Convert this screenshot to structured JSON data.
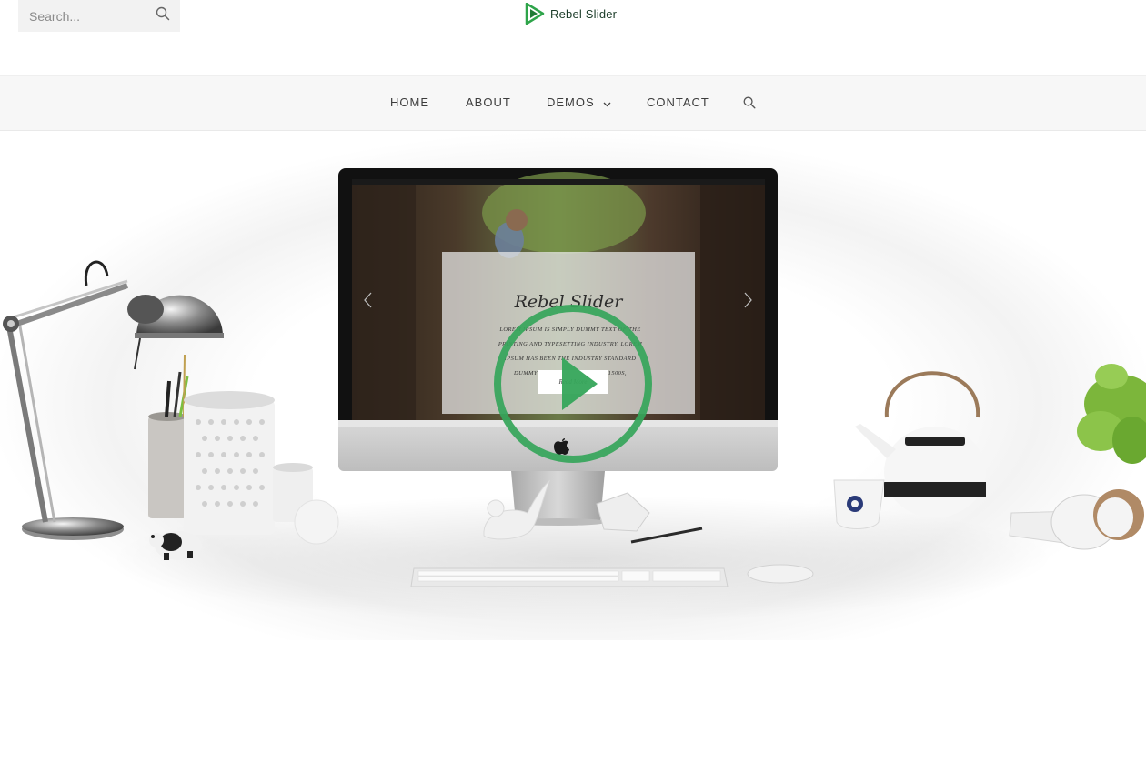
{
  "header": {
    "search_placeholder": "Search...",
    "logo_text": "Rebel Slider"
  },
  "nav": {
    "items": [
      {
        "label": "HOME"
      },
      {
        "label": "ABOUT"
      },
      {
        "label": "DEMOS"
      },
      {
        "label": "CONTACT"
      }
    ]
  },
  "slide": {
    "title": "Rebel Slider",
    "body": "Lorem Ipsum is simply dummy text of the printing and typesetting industry. Lorem Ipsum has been the industry standard dummy text ever since the 1500s,",
    "button_label": "Read More"
  },
  "colors": {
    "accent": "#35a55a",
    "nav_bg": "#f7f7f7"
  }
}
